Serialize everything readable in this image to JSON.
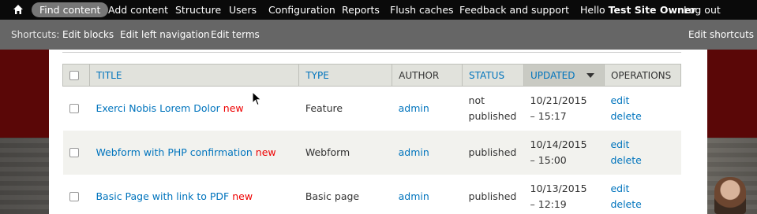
{
  "toolbar": {
    "home_icon": "home-icon",
    "items": [
      "Find content",
      "Add content",
      "Structure",
      "Users",
      "Configuration",
      "Reports",
      "Flush caches",
      "Feedback and support"
    ],
    "hello_prefix": "Hello",
    "username": "Test Site Owner",
    "logout": "Log out"
  },
  "shortcuts": {
    "label": "Shortcuts:",
    "items": [
      "Edit blocks",
      "Edit left navigation",
      "Edit terms"
    ],
    "edit_shortcuts": "Edit shortcuts"
  },
  "table": {
    "headers": {
      "title": "Title",
      "type": "Type",
      "author": "Author",
      "status": "Status",
      "updated": "Updated",
      "operations": "Operations"
    },
    "sort_indicator": "caret-down-icon",
    "new_marker": "new",
    "rows": [
      {
        "title": "Exerci Nobis Lorem Dolor",
        "type": "Feature",
        "author": "admin",
        "status_line1": "not",
        "status_line2": "published",
        "updated_line1": "10/21/2015",
        "updated_line2": "– 15:17",
        "op_edit": "edit",
        "op_delete": "delete"
      },
      {
        "title": "Webform with PHP confirmation",
        "type": "Webform",
        "author": "admin",
        "status_line1": "published",
        "status_line2": "",
        "updated_line1": "10/14/2015",
        "updated_line2": "– 15:00",
        "op_edit": "edit",
        "op_delete": "delete"
      },
      {
        "title": "Basic Page with link to PDF",
        "type": "Basic page",
        "author": "admin",
        "status_line1": "published",
        "status_line2": "",
        "updated_line1": "10/13/2015",
        "updated_line2": "– 12:19",
        "op_edit": "edit",
        "op_delete": "delete"
      }
    ]
  },
  "colors": {
    "link": "#0074bd",
    "new_marker": "#ee0000",
    "toolbar_bg": "#0a0a0a",
    "shortcuts_bg": "#666666",
    "active_pill": "#777777"
  }
}
